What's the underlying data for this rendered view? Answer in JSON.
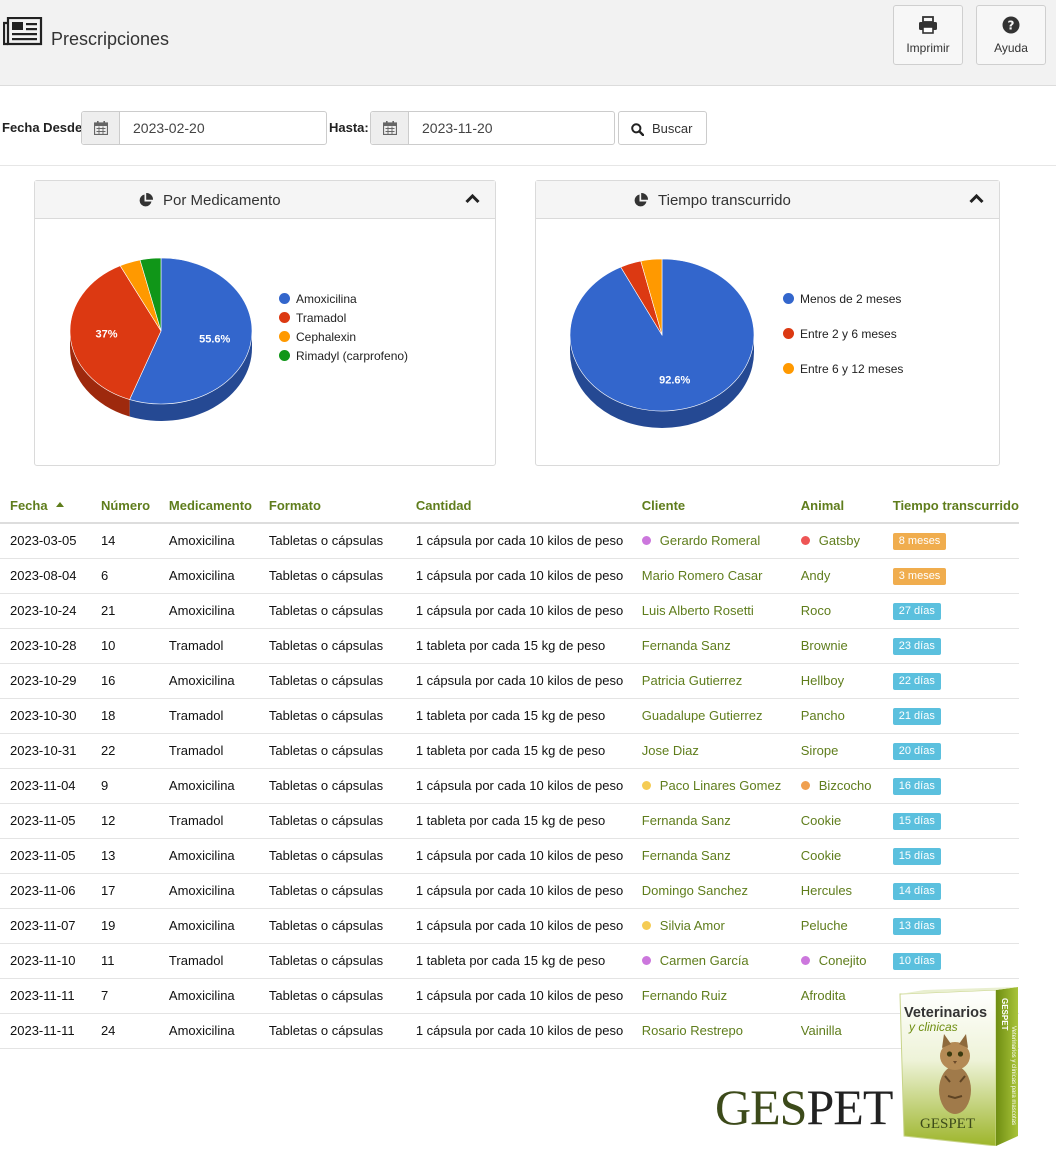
{
  "header": {
    "title": "Prescripciones",
    "print_label": "Imprimir",
    "help_label": "Ayuda"
  },
  "filters": {
    "from_label": "Fecha Desde:",
    "from_value": "2023-02-20",
    "to_label": "Hasta:",
    "to_value": "2023-11-20",
    "search_label": "Buscar"
  },
  "panels": {
    "medication": {
      "title": "Por Medicamento",
      "legend": [
        "Amoxicilina",
        "Tramadol",
        "Cephalexin",
        "Rimadyl (carprofeno)"
      ],
      "labels": [
        "55.6%",
        "37%"
      ]
    },
    "elapsed": {
      "title": "Tiempo transcurrido",
      "legend": [
        "Menos de 2 meses",
        "Entre 2 y 6 meses",
        "Entre 6 y 12 meses"
      ],
      "labels": [
        "92.6%"
      ]
    }
  },
  "chart_data": [
    {
      "type": "pie",
      "title": "Por Medicamento",
      "categories": [
        "Amoxicilina",
        "Tramadol",
        "Cephalexin",
        "Rimadyl (carprofeno)"
      ],
      "values": [
        55.6,
        37.0,
        3.7,
        3.7
      ],
      "colors": [
        "#3366cc",
        "#dc3912",
        "#ff9900",
        "#109618"
      ],
      "legend": "right"
    },
    {
      "type": "pie",
      "title": "Tiempo transcurrido",
      "categories": [
        "Menos de 2 meses",
        "Entre 2 y 6 meses",
        "Entre 6 y 12 meses"
      ],
      "values": [
        92.6,
        3.7,
        3.7
      ],
      "colors": [
        "#3366cc",
        "#dc3912",
        "#ff9900"
      ],
      "legend": "right"
    }
  ],
  "table": {
    "columns": [
      "Fecha",
      "Número",
      "Medicamento",
      "Formato",
      "Cantidad",
      "Cliente",
      "Animal",
      "Tiempo transcurrido"
    ],
    "rows": [
      {
        "fecha": "2023-03-05",
        "numero": "14",
        "medicamento": "Amoxicilina",
        "formato": "Tabletas o cápsulas",
        "cantidad": "1 cápsula por cada 10 kilos de peso",
        "cliente": "Gerardo Romeral",
        "cliente_dot": "#cc77dd",
        "animal": "Gatsby",
        "animal_dot": "#ee5555",
        "tiempo": "8 meses",
        "tiempo_color": "#f0ad4e"
      },
      {
        "fecha": "2023-08-04",
        "numero": "6",
        "medicamento": "Amoxicilina",
        "formato": "Tabletas o cápsulas",
        "cantidad": "1 cápsula por cada 10 kilos de peso",
        "cliente": "Mario Romero Casar",
        "cliente_dot": "",
        "animal": "Andy",
        "animal_dot": "",
        "tiempo": "3 meses",
        "tiempo_color": "#f0ad4e"
      },
      {
        "fecha": "2023-10-24",
        "numero": "21",
        "medicamento": "Amoxicilina",
        "formato": "Tabletas o cápsulas",
        "cantidad": "1 cápsula por cada 10 kilos de peso",
        "cliente": "Luis Alberto Rosetti",
        "cliente_dot": "",
        "animal": "Roco",
        "animal_dot": "",
        "tiempo": "27 días",
        "tiempo_color": "#5bc0de"
      },
      {
        "fecha": "2023-10-28",
        "numero": "10",
        "medicamento": "Tramadol",
        "formato": "Tabletas o cápsulas",
        "cantidad": "1 tableta por cada 15 kg de peso",
        "cliente": "Fernanda Sanz",
        "cliente_dot": "",
        "animal": "Brownie",
        "animal_dot": "",
        "tiempo": "23 días",
        "tiempo_color": "#5bc0de"
      },
      {
        "fecha": "2023-10-29",
        "numero": "16",
        "medicamento": "Amoxicilina",
        "formato": "Tabletas o cápsulas",
        "cantidad": "1 cápsula por cada 10 kilos de peso",
        "cliente": "Patricia Gutierrez",
        "cliente_dot": "",
        "animal": "Hellboy",
        "animal_dot": "",
        "tiempo": "22 días",
        "tiempo_color": "#5bc0de"
      },
      {
        "fecha": "2023-10-30",
        "numero": "18",
        "medicamento": "Tramadol",
        "formato": "Tabletas o cápsulas",
        "cantidad": "1 tableta por cada 15 kg de peso",
        "cliente": "Guadalupe Gutierrez",
        "cliente_dot": "",
        "animal": "Pancho",
        "animal_dot": "",
        "tiempo": "21 días",
        "tiempo_color": "#5bc0de"
      },
      {
        "fecha": "2023-10-31",
        "numero": "22",
        "medicamento": "Tramadol",
        "formato": "Tabletas o cápsulas",
        "cantidad": "1 tableta por cada 15 kg de peso",
        "cliente": "Jose Diaz",
        "cliente_dot": "",
        "animal": "Sirope",
        "animal_dot": "",
        "tiempo": "20 días",
        "tiempo_color": "#5bc0de"
      },
      {
        "fecha": "2023-11-04",
        "numero": "9",
        "medicamento": "Amoxicilina",
        "formato": "Tabletas o cápsulas",
        "cantidad": "1 cápsula por cada 10 kilos de peso",
        "cliente": "Paco Linares Gomez",
        "cliente_dot": "#f5cc55",
        "animal": "Bizcocho",
        "animal_dot": "#f0a050",
        "tiempo": "16 días",
        "tiempo_color": "#5bc0de"
      },
      {
        "fecha": "2023-11-05",
        "numero": "12",
        "medicamento": "Tramadol",
        "formato": "Tabletas o cápsulas",
        "cantidad": "1 tableta por cada 15 kg de peso",
        "cliente": "Fernanda Sanz",
        "cliente_dot": "",
        "animal": "Cookie",
        "animal_dot": "",
        "tiempo": "15 días",
        "tiempo_color": "#5bc0de"
      },
      {
        "fecha": "2023-11-05",
        "numero": "13",
        "medicamento": "Amoxicilina",
        "formato": "Tabletas o cápsulas",
        "cantidad": "1 cápsula por cada 10 kilos de peso",
        "cliente": "Fernanda Sanz",
        "cliente_dot": "",
        "animal": "Cookie",
        "animal_dot": "",
        "tiempo": "15 días",
        "tiempo_color": "#5bc0de"
      },
      {
        "fecha": "2023-11-06",
        "numero": "17",
        "medicamento": "Amoxicilina",
        "formato": "Tabletas o cápsulas",
        "cantidad": "1 cápsula por cada 10 kilos de peso",
        "cliente": "Domingo Sanchez",
        "cliente_dot": "",
        "animal": "Hercules",
        "animal_dot": "",
        "tiempo": "14 días",
        "tiempo_color": "#5bc0de"
      },
      {
        "fecha": "2023-11-07",
        "numero": "19",
        "medicamento": "Amoxicilina",
        "formato": "Tabletas o cápsulas",
        "cantidad": "1 cápsula por cada 10 kilos de peso",
        "cliente": "Silvia Amor",
        "cliente_dot": "#f5cc55",
        "animal": "Peluche",
        "animal_dot": "",
        "tiempo": "13 días",
        "tiempo_color": "#5bc0de"
      },
      {
        "fecha": "2023-11-10",
        "numero": "11",
        "medicamento": "Tramadol",
        "formato": "Tabletas o cápsulas",
        "cantidad": "1 tableta por cada 15 kg de peso",
        "cliente": "Carmen García",
        "cliente_dot": "#cc77dd",
        "animal": "Conejito",
        "animal_dot": "#cc77dd",
        "tiempo": "10 días",
        "tiempo_color": "#5bc0de"
      },
      {
        "fecha": "2023-11-11",
        "numero": "7",
        "medicamento": "Amoxicilina",
        "formato": "Tabletas o cápsulas",
        "cantidad": "1 cápsula por cada 10 kilos de peso",
        "cliente": "Fernando Ruiz",
        "cliente_dot": "",
        "animal": "Afrodita",
        "animal_dot": "",
        "tiempo": "",
        "tiempo_color": ""
      },
      {
        "fecha": "2023-11-11",
        "numero": "24",
        "medicamento": "Amoxicilina",
        "formato": "Tabletas o cápsulas",
        "cantidad": "1 cápsula por cada 10 kilos de peso",
        "cliente": "Rosario Restrepo",
        "cliente_dot": "",
        "animal": "Vainilla",
        "animal_dot": "",
        "tiempo": "",
        "tiempo_color": ""
      }
    ]
  },
  "branding": {
    "word_ges": "GES",
    "word_pet": "PET",
    "box_title_1": "Veterinarios",
    "box_title_2": "y clinicas",
    "box_side": "GESPET",
    "box_spine": "Veterinarios y clínicas para mascotas",
    "box_brand": "GESPET"
  },
  "colors": {
    "accent": "#5f7d1c",
    "badge_months": "#f0ad4e",
    "badge_days": "#5bc0de"
  }
}
